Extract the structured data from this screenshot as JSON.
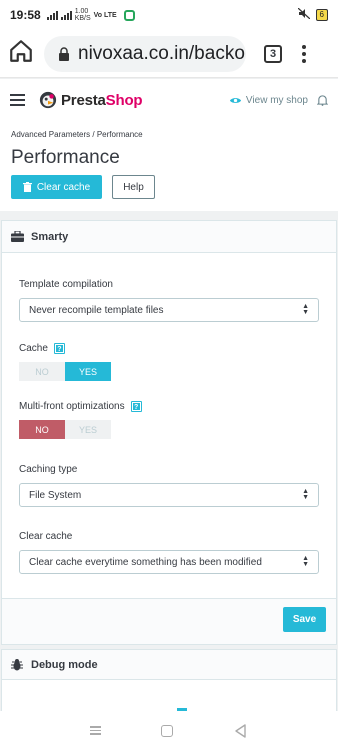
{
  "status": {
    "time": "19:58",
    "net_speed_top": "1.00",
    "net_speed_unit": "KB/S",
    "volte": "Vo LTE",
    "battery": "6"
  },
  "browser": {
    "url": "nivoxaa.co.in/backo",
    "tab_count": "3"
  },
  "header": {
    "logo_presta": "Presta",
    "logo_shop": "Shop",
    "view_shop": "View my shop"
  },
  "page": {
    "breadcrumb": "Advanced Parameters /  Performance",
    "title": "Performance",
    "clear_cache_button": "Clear cache",
    "help_button": "Help"
  },
  "smarty": {
    "title": "Smarty",
    "template_compilation": {
      "label": "Template compilation",
      "value": "Never recompile template files"
    },
    "cache": {
      "label": "Cache",
      "no": "NO",
      "yes": "YES",
      "selected": "YES"
    },
    "multifront": {
      "label": "Multi-front optimizations",
      "no": "NO",
      "yes": "YES",
      "selected": "NO"
    },
    "caching_type": {
      "label": "Caching type",
      "value": "File System"
    },
    "clear_cache": {
      "label": "Clear cache",
      "value": "Clear cache everytime something has been modified"
    },
    "save_button": "Save",
    "help_mark": "?"
  },
  "debug": {
    "title": "Debug mode"
  },
  "colors": {
    "accent": "#25b9d7",
    "danger": "#c05c67",
    "brand_pink": "#df0067"
  },
  "icons": [
    "home-icon",
    "lock-icon",
    "eye-icon",
    "bell-icon",
    "trash-icon",
    "briefcase-icon",
    "bug-icon"
  ]
}
